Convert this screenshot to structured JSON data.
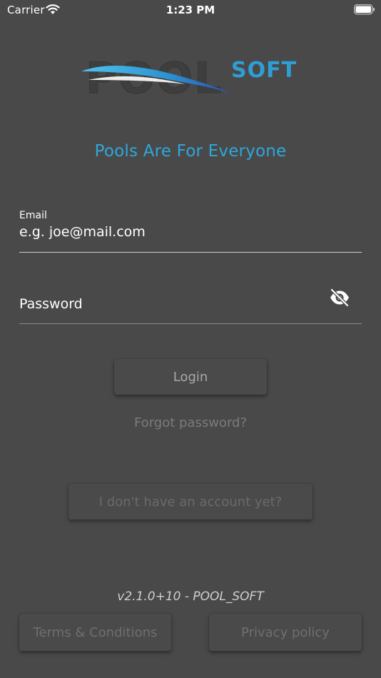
{
  "status_bar": {
    "carrier": "Carrier",
    "time": "1:23 PM"
  },
  "logo": {
    "word": "POOL",
    "suffix": "SOFT"
  },
  "tagline": "Pools Are For Everyone",
  "email": {
    "label": "Email",
    "value": "e.g. joe@mail.com"
  },
  "password": {
    "placeholder": "Password"
  },
  "buttons": {
    "login": "Login",
    "forgot": "Forgot password?",
    "no_account": "I don't have an account yet?",
    "terms": "Terms & Conditions",
    "privacy": "Privacy policy"
  },
  "version": "v2.1.0+10 - POOL_SOFT",
  "colors": {
    "background": "#494949",
    "accent_blue": "#2fa7da"
  }
}
